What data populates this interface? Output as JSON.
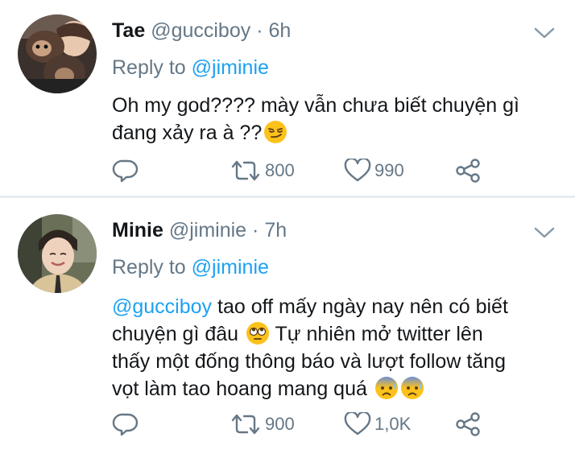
{
  "tweets": [
    {
      "name": "Tae",
      "handle": "@gucciboy",
      "dot": "·",
      "time": "6h",
      "reply_prefix": "Reply to",
      "reply_handle": "@jiminie",
      "body_line1": "Oh my god???? mày vẫn chưa biết chuyện gì",
      "body_line2": "đang xảy ra à ??",
      "retweets": "800",
      "likes": "990",
      "emoji": [
        "smirking-face"
      ]
    },
    {
      "name": "Minie",
      "handle": "@jiminie",
      "dot": "·",
      "time": "7h",
      "reply_prefix": "Reply to",
      "reply_handle": "@jiminie",
      "body_mention": "@gucciboy",
      "body_line1": " tao off mấy ngày nay nên có biết",
      "body_line2": "chuyện gì đâu ",
      "body_line2b": " Tự nhiên mở twitter lên",
      "body_line3": "thấy một đống thông báo và lượt follow tăng",
      "body_line4": "vọt làm tao hoang mang quá ",
      "retweets": "900",
      "likes": "1,0K",
      "emoji": [
        "face-with-rolling-eyes",
        "anxious-face-with-sweat",
        "anxious-face-with-sweat"
      ]
    }
  ],
  "colors": {
    "link": "#1da1f2",
    "muted": "#657786",
    "text": "#14171a",
    "divider": "#e6ecf0"
  }
}
